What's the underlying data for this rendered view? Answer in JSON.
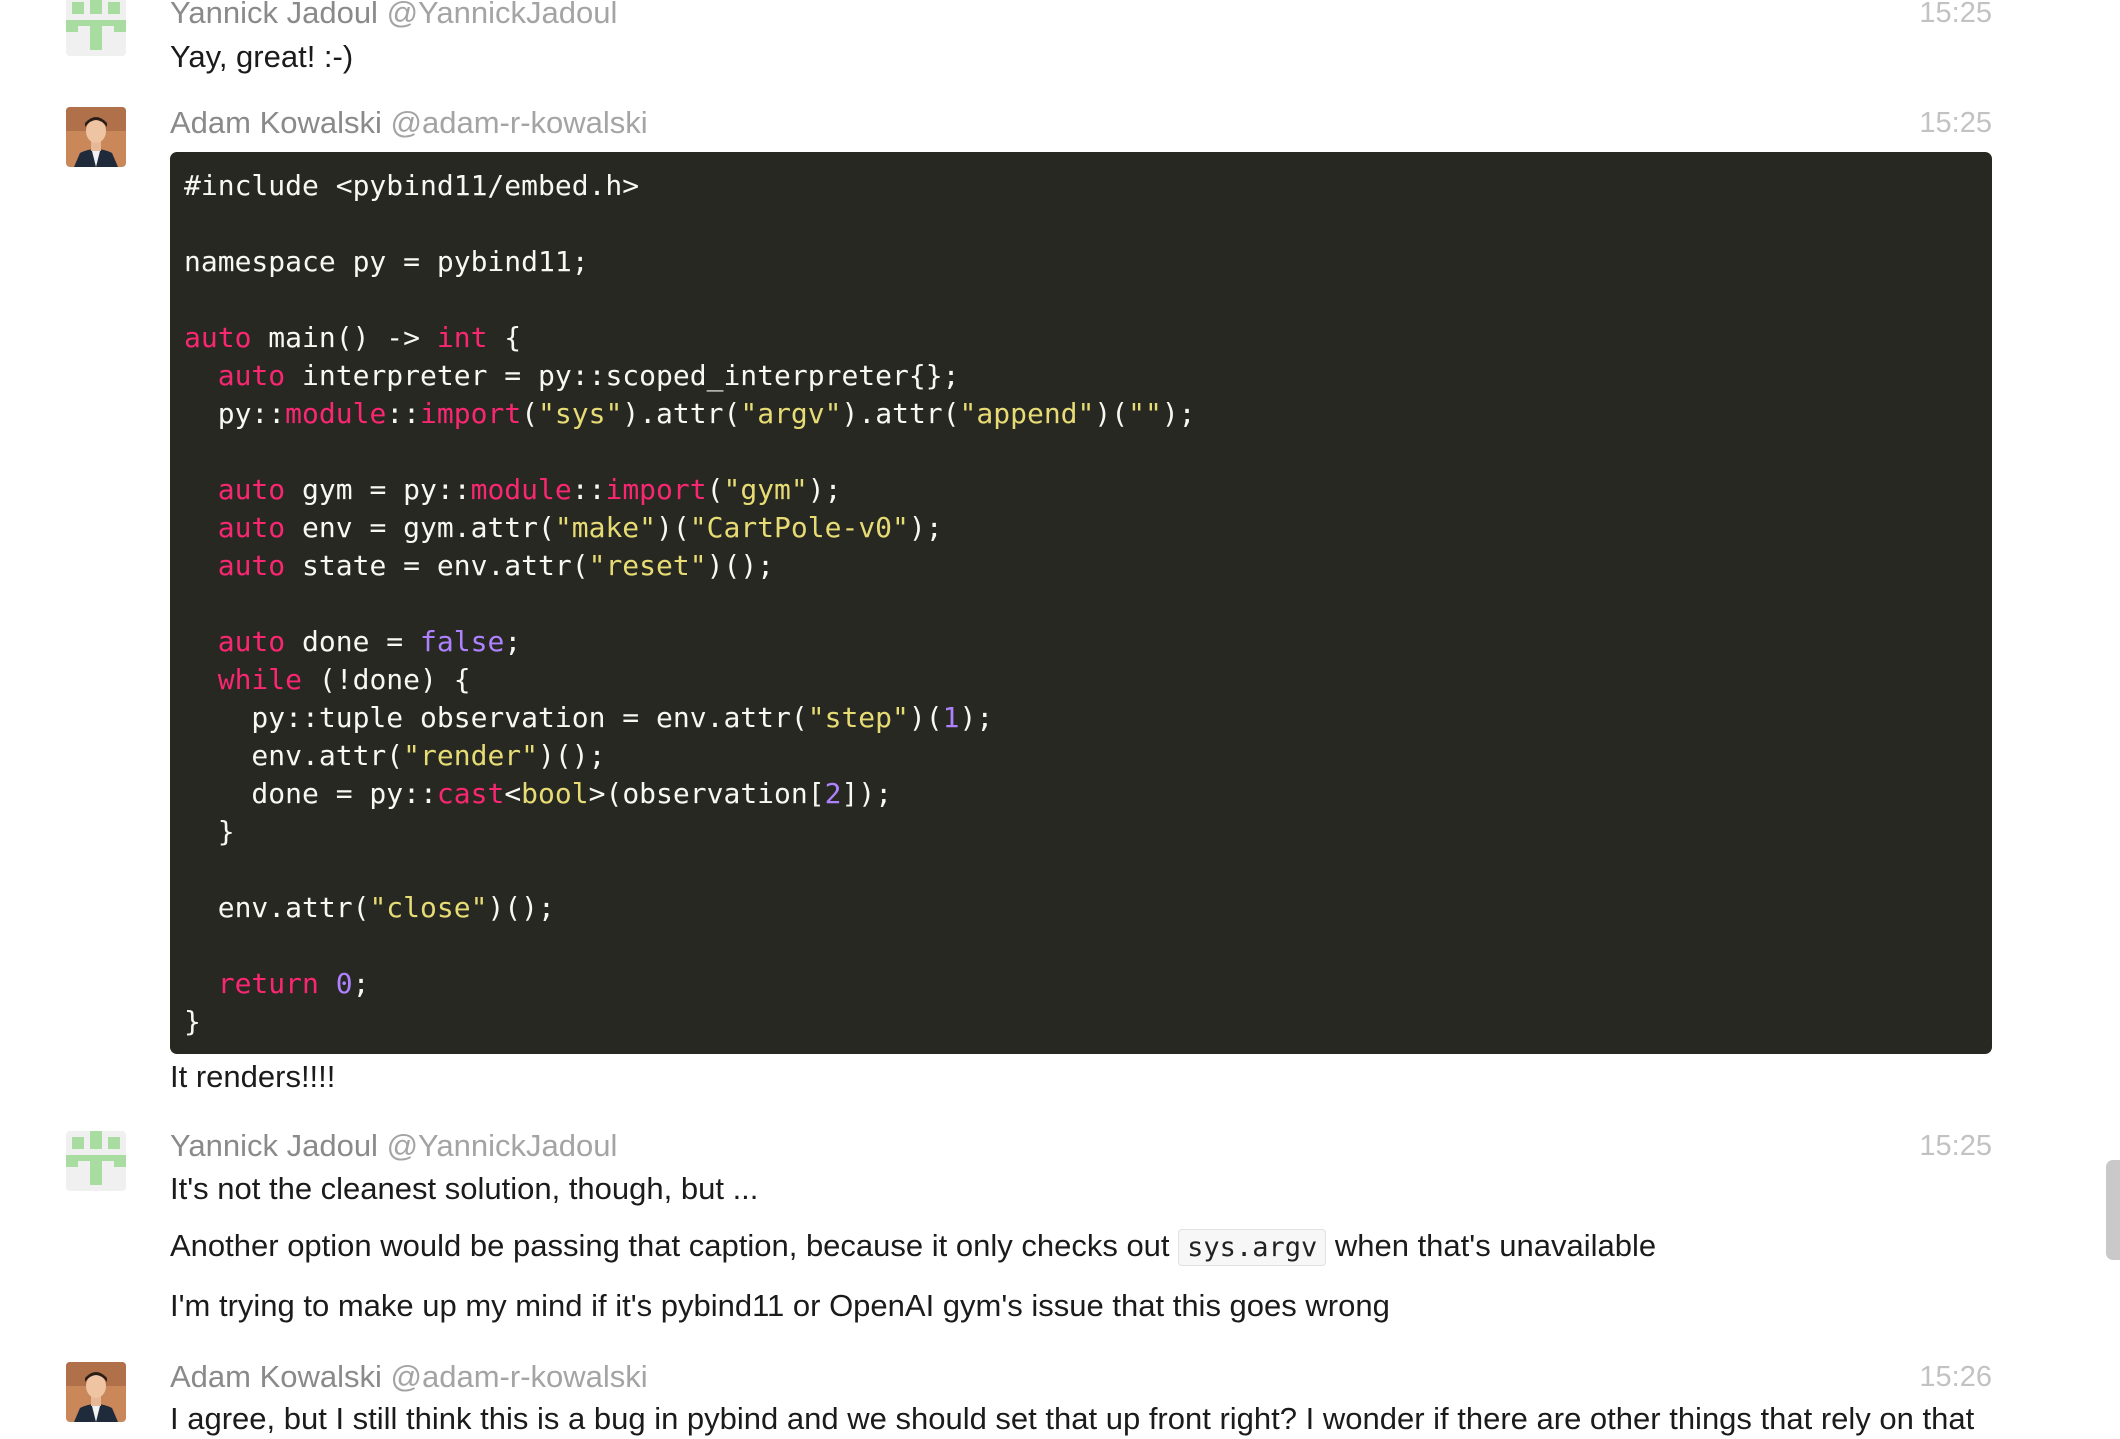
{
  "messages": [
    {
      "author": "Yannick Jadoul",
      "handle": "@YannickJadoul",
      "time": "15:25",
      "lines": [
        "Yay, great! :-)"
      ],
      "avatar": "identicon-green"
    },
    {
      "author": "Adam Kowalski",
      "handle": "@adam-r-kowalski",
      "time": "15:25",
      "avatar": "photo-man-suit",
      "code": [
        [
          {
            "t": "#include <pybind11/embed.h>",
            "c": "p"
          }
        ],
        [],
        [
          {
            "t": "namespace py = pybind11;",
            "c": "p"
          }
        ],
        [],
        [
          {
            "t": "auto",
            "c": "k"
          },
          {
            "t": " main() -> ",
            "c": "p"
          },
          {
            "t": "int",
            "c": "k"
          },
          {
            "t": " {",
            "c": "p"
          }
        ],
        [
          {
            "t": "  ",
            "c": "p"
          },
          {
            "t": "auto",
            "c": "k"
          },
          {
            "t": " interpreter = py::scoped_interpreter{};",
            "c": "p"
          }
        ],
        [
          {
            "t": "  py::",
            "c": "p"
          },
          {
            "t": "module",
            "c": "k"
          },
          {
            "t": "::",
            "c": "p"
          },
          {
            "t": "import",
            "c": "k"
          },
          {
            "t": "(",
            "c": "p"
          },
          {
            "t": "\"sys\"",
            "c": "s"
          },
          {
            "t": ").attr(",
            "c": "p"
          },
          {
            "t": "\"argv\"",
            "c": "s"
          },
          {
            "t": ").attr(",
            "c": "p"
          },
          {
            "t": "\"append\"",
            "c": "s"
          },
          {
            "t": ")(",
            "c": "p"
          },
          {
            "t": "\"\"",
            "c": "s"
          },
          {
            "t": ");",
            "c": "p"
          }
        ],
        [],
        [
          {
            "t": "  ",
            "c": "p"
          },
          {
            "t": "auto",
            "c": "k"
          },
          {
            "t": " gym = py::",
            "c": "p"
          },
          {
            "t": "module",
            "c": "k"
          },
          {
            "t": "::",
            "c": "p"
          },
          {
            "t": "import",
            "c": "k"
          },
          {
            "t": "(",
            "c": "p"
          },
          {
            "t": "\"gym\"",
            "c": "s"
          },
          {
            "t": ");",
            "c": "p"
          }
        ],
        [
          {
            "t": "  ",
            "c": "p"
          },
          {
            "t": "auto",
            "c": "k"
          },
          {
            "t": " env = gym.attr(",
            "c": "p"
          },
          {
            "t": "\"make\"",
            "c": "s"
          },
          {
            "t": ")(",
            "c": "p"
          },
          {
            "t": "\"CartPole-v0\"",
            "c": "s"
          },
          {
            "t": ");",
            "c": "p"
          }
        ],
        [
          {
            "t": "  ",
            "c": "p"
          },
          {
            "t": "auto",
            "c": "k"
          },
          {
            "t": " state = env.attr(",
            "c": "p"
          },
          {
            "t": "\"reset\"",
            "c": "s"
          },
          {
            "t": ")();",
            "c": "p"
          }
        ],
        [],
        [
          {
            "t": "  ",
            "c": "p"
          },
          {
            "t": "auto",
            "c": "k"
          },
          {
            "t": " done = ",
            "c": "p"
          },
          {
            "t": "false",
            "c": "n"
          },
          {
            "t": ";",
            "c": "p"
          }
        ],
        [
          {
            "t": "  ",
            "c": "p"
          },
          {
            "t": "while",
            "c": "k"
          },
          {
            "t": " (!done) {",
            "c": "p"
          }
        ],
        [
          {
            "t": "    py::tuple observation = env.attr(",
            "c": "p"
          },
          {
            "t": "\"step\"",
            "c": "s"
          },
          {
            "t": ")(",
            "c": "p"
          },
          {
            "t": "1",
            "c": "n"
          },
          {
            "t": ");",
            "c": "p"
          }
        ],
        [
          {
            "t": "    env.attr(",
            "c": "p"
          },
          {
            "t": "\"render\"",
            "c": "s"
          },
          {
            "t": ")();",
            "c": "p"
          }
        ],
        [
          {
            "t": "    done = py::",
            "c": "p"
          },
          {
            "t": "cast",
            "c": "k"
          },
          {
            "t": "<",
            "c": "p"
          },
          {
            "t": "bool",
            "c": "s"
          },
          {
            "t": ">(observation[",
            "c": "p"
          },
          {
            "t": "2",
            "c": "n"
          },
          {
            "t": "]);",
            "c": "p"
          }
        ],
        [
          {
            "t": "  }",
            "c": "p"
          }
        ],
        [],
        [
          {
            "t": "  env.attr(",
            "c": "p"
          },
          {
            "t": "\"close\"",
            "c": "s"
          },
          {
            "t": ")();",
            "c": "p"
          }
        ],
        [],
        [
          {
            "t": "  ",
            "c": "p"
          },
          {
            "t": "return",
            "c": "k"
          },
          {
            "t": " ",
            "c": "p"
          },
          {
            "t": "0",
            "c": "n"
          },
          {
            "t": ";",
            "c": "p"
          }
        ],
        [
          {
            "t": "}",
            "c": "p"
          }
        ]
      ],
      "after_code": "It renders!!!!"
    },
    {
      "author": "Yannick Jadoul",
      "handle": "@YannickJadoul",
      "time": "15:25",
      "avatar": "identicon-green",
      "line1": "It's not the cleanest solution, though, but ...",
      "line2_before": "Another option would be passing that caption, because it only checks out",
      "line2_code": "sys.argv",
      "line2_after": "when that's unavailable",
      "line3": "I'm trying to make up my mind if it's pybind11 or OpenAI gym's issue that this goes wrong"
    },
    {
      "author": "Adam Kowalski",
      "handle": "@adam-r-kowalski",
      "time": "15:26",
      "avatar": "photo-man-suit",
      "line1": "I agree, but I still think this is a bug in pybind and we should set that up front right? I wonder if there are other things that rely on that"
    }
  ],
  "colors": {
    "code_bg": "#272822",
    "keyword": "#f92672",
    "string": "#e6db74",
    "number": "#ae81ff",
    "identicon": "#a8dca0"
  }
}
